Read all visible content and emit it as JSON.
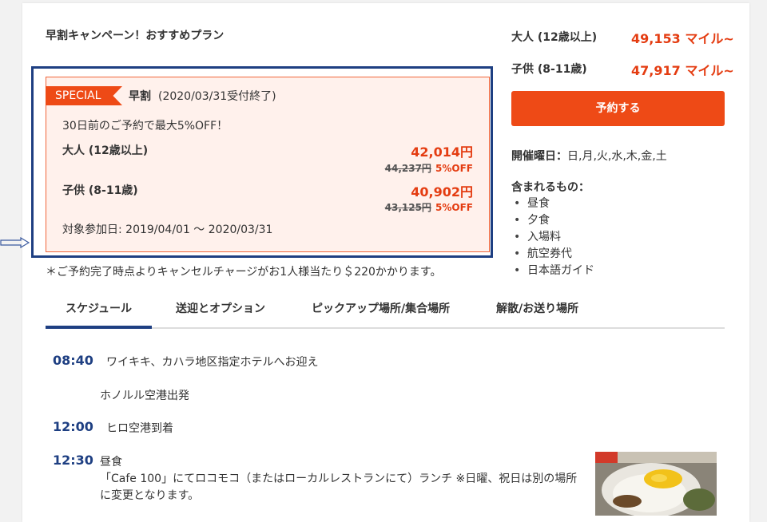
{
  "plan": {
    "title": "早割キャンペーン！おすすめプラン",
    "special_label": "SPECIAL",
    "early_name": "早割",
    "early_period": "(2020/03/31受付終了)",
    "description": "30日前のご予約で最大5%OFF！",
    "adult": {
      "label": "大人 (12歳以上)",
      "price": "42,014円",
      "original_price": "44,237円",
      "discount": "5%OFF"
    },
    "child": {
      "label": "子供 (8-11歳)",
      "price": "40,902円",
      "original_price": "43,125円",
      "discount": "5%OFF"
    },
    "target_dates": "対象参加日: 2019/04/01 〜 2020/03/31"
  },
  "cancel_note": "＊ご予約完了時点よりキャンセルチャージがお1人様当たり＄220かかります。",
  "sidebar": {
    "adult_label": "大人 (12歳以上)",
    "adult_price": "49,153 マイル~",
    "child_label": "子供 (8-11歳)",
    "child_price": "47,917 マイル~",
    "reserve_button": "予約する",
    "days_label": "開催曜日：",
    "days_value": "日,月,火,水,木,金,土",
    "included_title": "含まれるもの：",
    "included_items": [
      "昼食",
      "夕食",
      "入場料",
      "航空券代",
      "日本語ガイド"
    ]
  },
  "tabs": [
    "スケジュール",
    "送迎とオプション",
    "ピックアップ場所/集合場所",
    "解散/お送り場所"
  ],
  "schedule": [
    {
      "time": "08:40",
      "text": "ワイキキ、カハラ地区指定ホテルへお迎え"
    },
    {
      "time": "",
      "text": "ホノルル空港出発"
    },
    {
      "time": "12:00",
      "text": "ヒロ空港到着"
    },
    {
      "time": "12:30",
      "title": "昼食",
      "text": "「Cafe 100」にてロコモコ（またはローカルレストランにて）ランチ ※日曜、祝日は別の場所",
      "text2": "に変更となります。"
    }
  ],
  "colors": {
    "accent": "#ee4a16",
    "price_red": "#e43c11",
    "navy": "#1e3f82",
    "special_bg": "#fff1ec"
  }
}
